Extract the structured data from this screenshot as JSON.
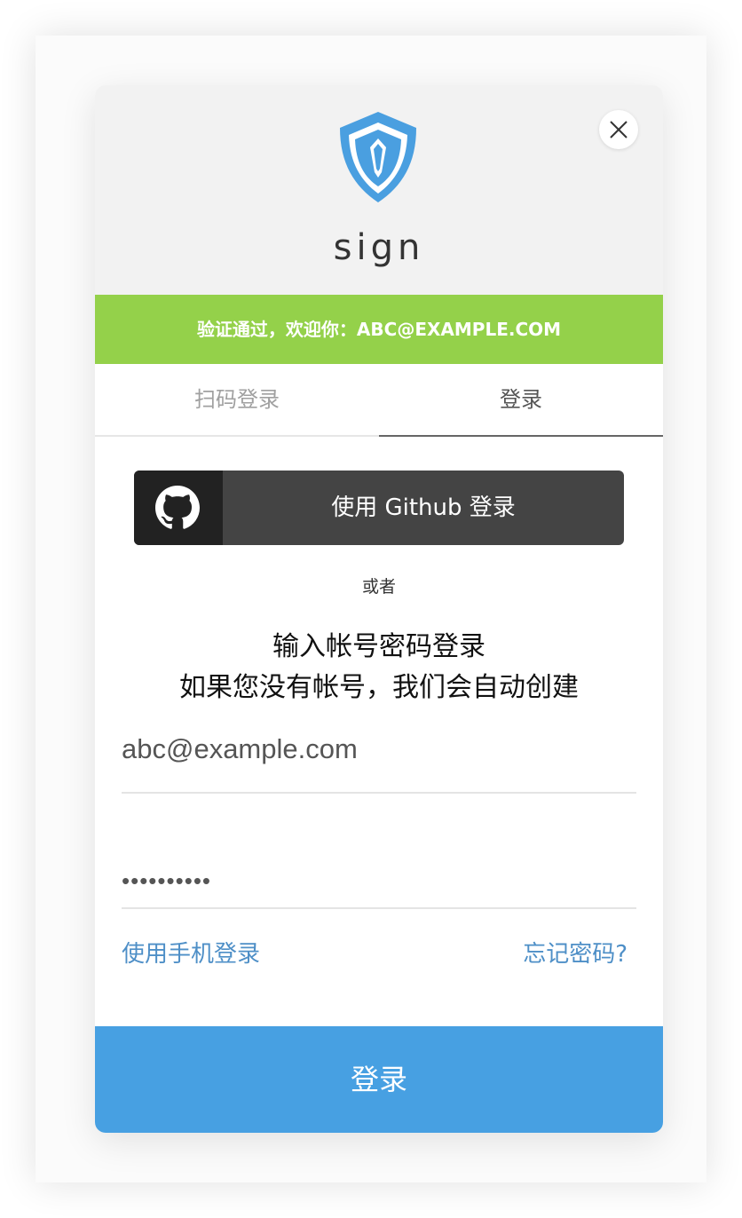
{
  "app": {
    "name": "sign",
    "logo_icon": "shield-icon",
    "close_icon": "close-icon"
  },
  "banner": {
    "text": "验证通过，欢迎你：ABC@EXAMPLE.COM",
    "color": "#94d14a"
  },
  "tabs": [
    {
      "label": "扫码登录",
      "active": false
    },
    {
      "label": "登录",
      "active": true
    }
  ],
  "github": {
    "icon": "github-icon",
    "label": "使用 Github 登录"
  },
  "divider_text": "或者",
  "hint": {
    "line1": "输入帐号密码登录",
    "line2": "如果您没有帐号，我们会自动创建"
  },
  "form": {
    "email_value": "abc@example.com",
    "password_value": "••••••••••"
  },
  "links": {
    "phone_login": "使用手机登录",
    "forgot_password": "忘记密码?"
  },
  "submit": {
    "label": "登录",
    "color": "#47a0e2"
  }
}
